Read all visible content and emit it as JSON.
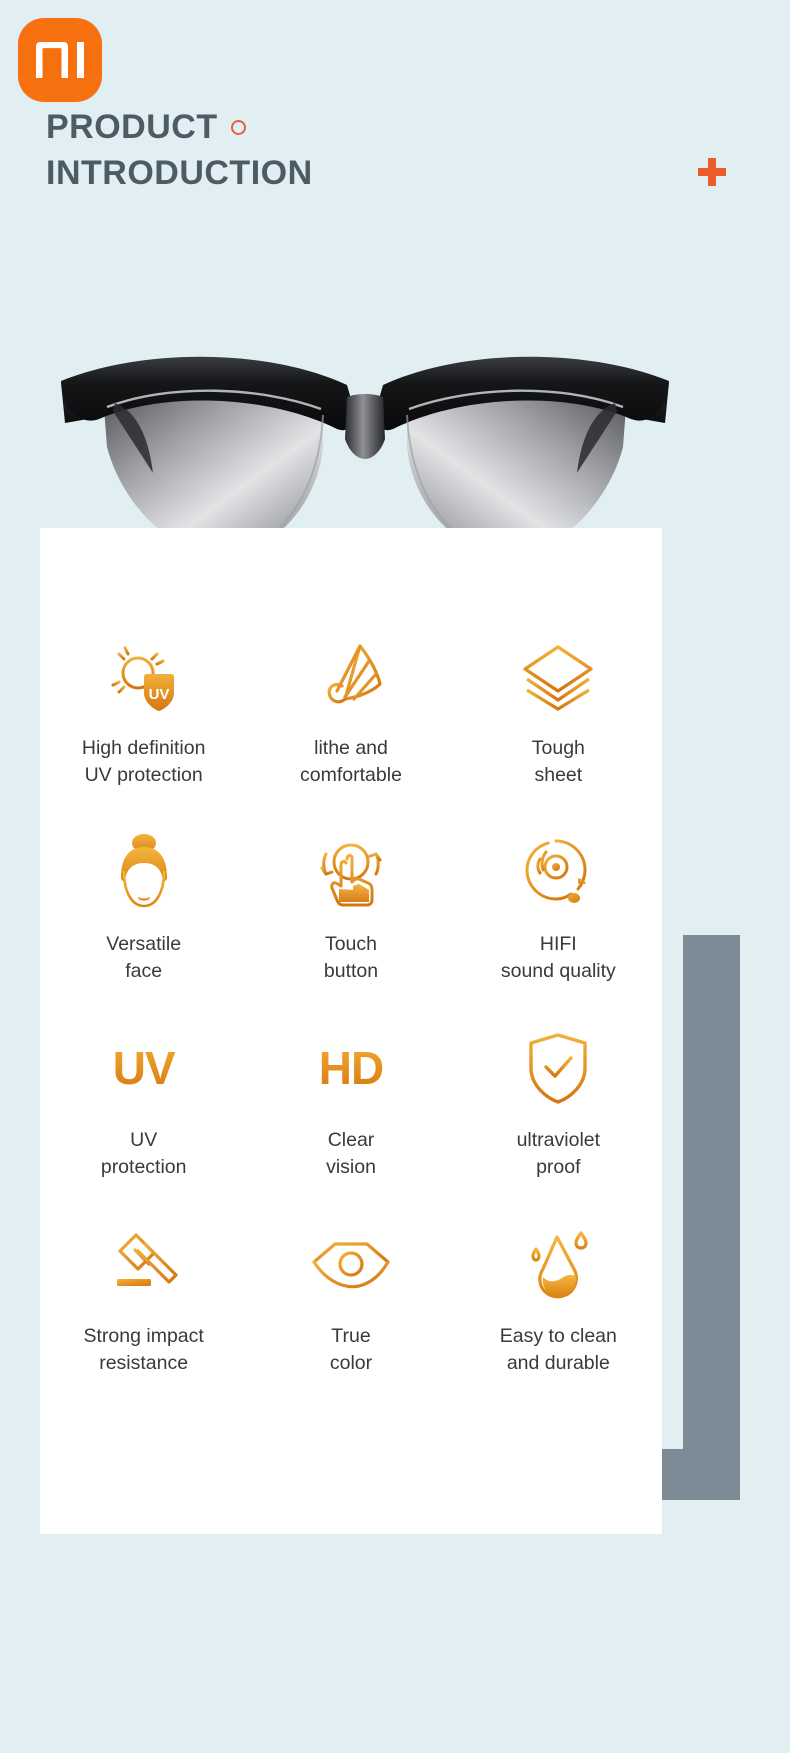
{
  "page": {
    "background_color": "#e1eff3",
    "card_color": "#ffffff",
    "shadow_color": "#7d8b96",
    "accent_orange": "#f7700f",
    "icon_gradient_from": "#f0a92c",
    "icon_gradient_to": "#d87b12",
    "text_color": "#3a3a3a",
    "heading_color": "#4d5b66"
  },
  "header": {
    "brand_logo": "mi-logo",
    "brand_name": "MI",
    "title_line1": "PRODUCT",
    "title_line2": "INTRODUCTION",
    "dot_marker": "circle-outline-marker",
    "plus_marker": "plus-marker"
  },
  "hero": {
    "product_image": "smart-audio-sunglasses",
    "frame_color": "#1b1c1e",
    "lens_color": "#c9cacc"
  },
  "features": [
    {
      "icon": "sun-uv-shield-icon",
      "icon_type": "svg",
      "label": "High definition\nUV protection",
      "badge_text": "UV"
    },
    {
      "icon": "shuttlecock-icon",
      "icon_type": "svg",
      "label": "lithe and\ncomfortable"
    },
    {
      "icon": "stacked-layers-icon",
      "icon_type": "svg",
      "label": "Tough\nsheet"
    },
    {
      "icon": "face-bun-icon",
      "icon_type": "svg",
      "label": "Versatile\nface"
    },
    {
      "icon": "touch-gesture-icon",
      "icon_type": "svg",
      "label": "Touch\nbutton"
    },
    {
      "icon": "audio-disc-note-icon",
      "icon_type": "svg",
      "label": "HIFI\nsound quality"
    },
    {
      "icon": "uv-text-icon",
      "icon_type": "text",
      "icon_text": "UV",
      "label": "UV\nprotection"
    },
    {
      "icon": "hd-text-icon",
      "icon_type": "text",
      "icon_text": "HD",
      "label": "Clear\nvision"
    },
    {
      "icon": "shield-check-icon",
      "icon_type": "svg",
      "label": "ultraviolet\nproof"
    },
    {
      "icon": "hammer-icon",
      "icon_type": "svg",
      "label": "Strong impact\nresistance"
    },
    {
      "icon": "eye-icon",
      "icon_type": "svg",
      "label": "True\ncolor"
    },
    {
      "icon": "water-droplet-icon",
      "icon_type": "svg",
      "label": "Easy to clean\nand durable"
    }
  ]
}
